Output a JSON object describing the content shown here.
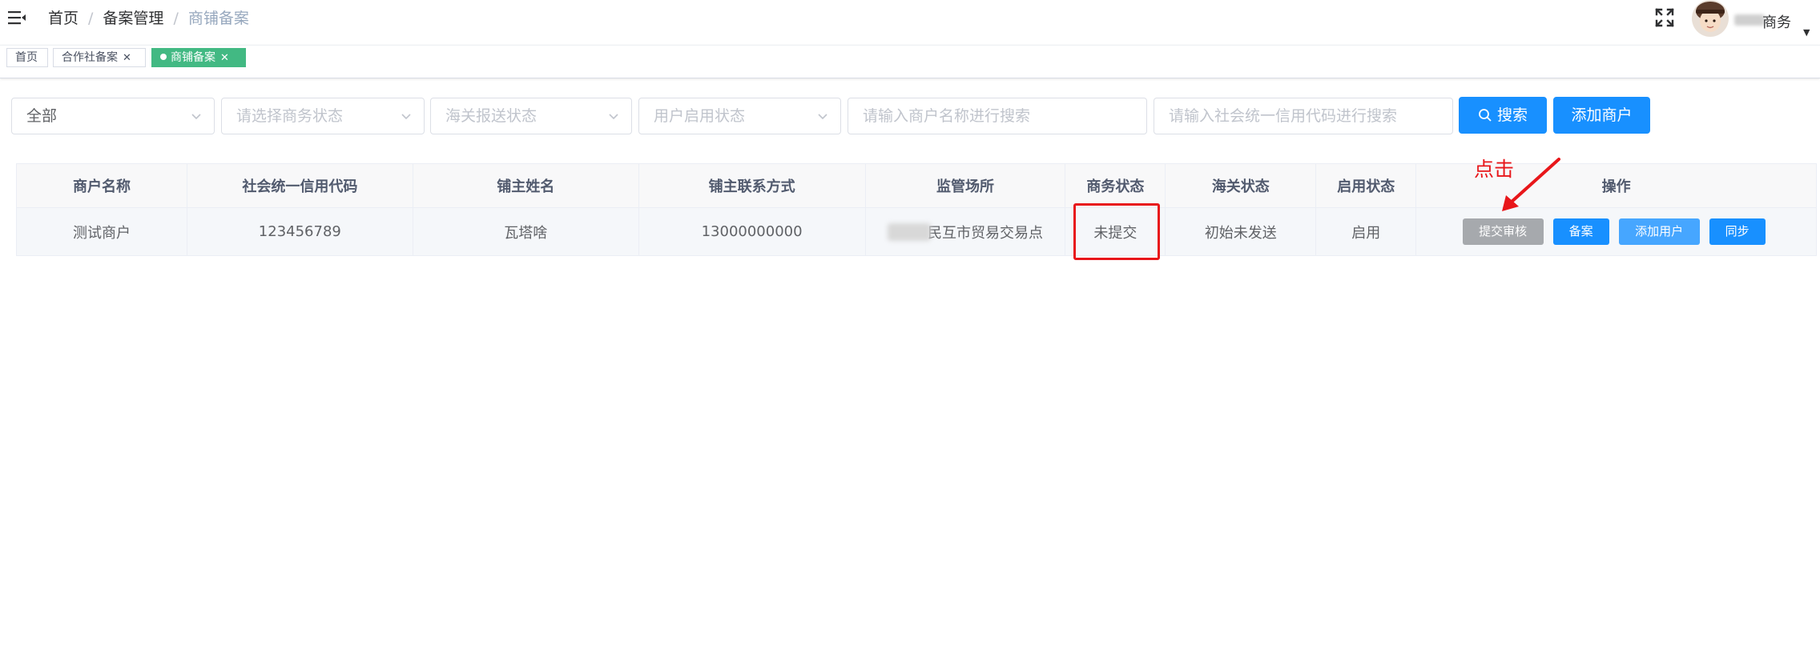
{
  "breadcrumb": {
    "items": [
      "首页",
      "备案管理",
      "商铺备案"
    ],
    "separator": "/"
  },
  "user": {
    "name": "商务"
  },
  "tags": [
    {
      "label": "首页",
      "active": false
    },
    {
      "label": "合作社备案",
      "active": false
    },
    {
      "label": "商铺备案",
      "active": true
    }
  ],
  "filters": {
    "scope_select": {
      "value": "全部"
    },
    "business_status_select": {
      "placeholder": "请选择商务状态"
    },
    "customs_status_select": {
      "placeholder": "海关报送状态"
    },
    "user_enable_select": {
      "placeholder": "用户启用状态"
    },
    "merchant_name_input": {
      "placeholder": "请输入商户名称进行搜索"
    },
    "credit_code_input": {
      "placeholder": "请输入社会统一信用代码进行搜索"
    },
    "search_label": "搜索",
    "add_label": "添加商户"
  },
  "table": {
    "headers": [
      "商户名称",
      "社会统一信用代码",
      "铺主姓名",
      "铺主联系方式",
      "监管场所",
      "商务状态",
      "海关状态",
      "启用状态",
      "操作"
    ],
    "rows": [
      {
        "merchant_name": "测试商户",
        "credit_code": "123456789",
        "owner_name": "瓦塔啥",
        "owner_phone": "13000000000",
        "location": "民互市贸易交易点",
        "business_status": "未提交",
        "customs_status": "初始未发送",
        "enable_status": "启用"
      }
    ],
    "actions": [
      "提交审核",
      "备案",
      "添加用户",
      "同步"
    ]
  },
  "annotation": {
    "text": "点击"
  },
  "colors": {
    "primary": "#1890ff",
    "tag_active": "#42b983",
    "action_disabled": "#a6a9ad",
    "action_light": "#46a6ff",
    "annotation": "#e8161a"
  }
}
